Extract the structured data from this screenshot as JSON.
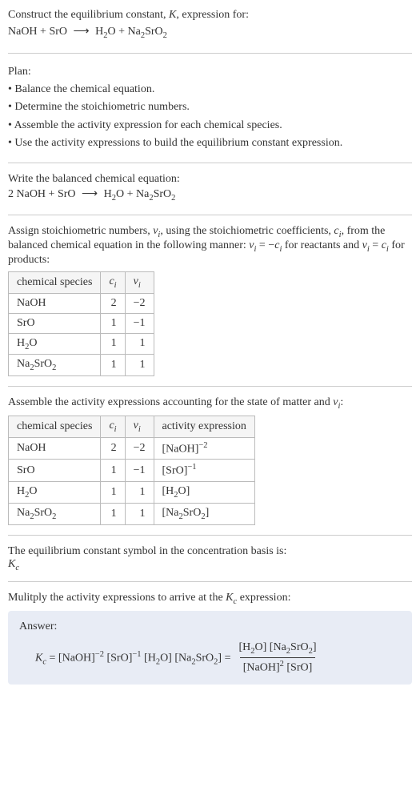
{
  "intro": {
    "line1_before": "Construct the equilibrium constant, ",
    "line1_K": "K",
    "line1_after": ", expression for:",
    "reaction_lhs1": "NaOH",
    "reaction_plus": " + ",
    "reaction_lhs2": "SrO",
    "reaction_arrow": "⟶",
    "reaction_rhs1": "H",
    "reaction_rhs1_sub": "2",
    "reaction_rhs1_end": "O",
    "reaction_rhs2": "Na",
    "reaction_rhs2_sub1": "2",
    "reaction_rhs2_mid": "SrO",
    "reaction_rhs2_sub2": "2"
  },
  "plan": {
    "header": "Plan:",
    "item1": "• Balance the chemical equation.",
    "item2": "• Determine the stoichiometric numbers.",
    "item3": "• Assemble the activity expression for each chemical species.",
    "item4": "• Use the activity expressions to build the equilibrium constant expression."
  },
  "balanced": {
    "header": "Write the balanced chemical equation:",
    "coef1": "2 ",
    "sp1": "NaOH",
    "plus": " + ",
    "sp2": "SrO",
    "arrow": "⟶",
    "sp3a": "H",
    "sp3sub": "2",
    "sp3b": "O",
    "sp4a": "Na",
    "sp4sub1": "2",
    "sp4b": "SrO",
    "sp4sub2": "2"
  },
  "stoich": {
    "text1": "Assign stoichiometric numbers, ",
    "nu": "ν",
    "nu_sub": "i",
    "text2": ", using the stoichiometric coefficients, ",
    "c": "c",
    "c_sub": "i",
    "text3": ", from the balanced chemical equation in the following manner: ",
    "eq1_lhs": "ν",
    "eq1_lhs_sub": "i",
    "eq1_eq": " = −",
    "eq1_rhs": "c",
    "eq1_rhs_sub": "i",
    "text4": " for reactants and ",
    "eq2_lhs": "ν",
    "eq2_lhs_sub": "i",
    "eq2_eq": " = ",
    "eq2_rhs": "c",
    "eq2_rhs_sub": "i",
    "text5": " for products:"
  },
  "table1": {
    "h1": "chemical species",
    "h2_sym": "c",
    "h2_sub": "i",
    "h3_sym": "ν",
    "h3_sub": "i",
    "rows": [
      {
        "sp": "NaOH",
        "sp_sub1": "",
        "sp_mid": "",
        "sp_sub2": "",
        "c": "2",
        "nu": "−2"
      },
      {
        "sp": "SrO",
        "sp_sub1": "",
        "sp_mid": "",
        "sp_sub2": "",
        "c": "1",
        "nu": "−1"
      },
      {
        "sp": "H",
        "sp_sub1": "2",
        "sp_mid": "O",
        "sp_sub2": "",
        "c": "1",
        "nu": "1"
      },
      {
        "sp": "Na",
        "sp_sub1": "2",
        "sp_mid": "SrO",
        "sp_sub2": "2",
        "c": "1",
        "nu": "1"
      }
    ]
  },
  "activity": {
    "text1": "Assemble the activity expressions accounting for the state of matter and ",
    "nu": "ν",
    "nu_sub": "i",
    "text2": ":"
  },
  "table2": {
    "h1": "chemical species",
    "h2_sym": "c",
    "h2_sub": "i",
    "h3_sym": "ν",
    "h3_sub": "i",
    "h4": "activity expression",
    "rows": [
      {
        "sp": "NaOH",
        "sp_sub1": "",
        "sp_mid": "",
        "sp_sub2": "",
        "c": "2",
        "nu": "−2",
        "act_open": "[NaOH]",
        "act_sup": "−2",
        "act_sub": ""
      },
      {
        "sp": "SrO",
        "sp_sub1": "",
        "sp_mid": "",
        "sp_sub2": "",
        "c": "1",
        "nu": "−1",
        "act_open": "[SrO]",
        "act_sup": "−1",
        "act_sub": ""
      },
      {
        "sp": "H",
        "sp_sub1": "2",
        "sp_mid": "O",
        "sp_sub2": "",
        "c": "1",
        "nu": "1",
        "act_open": "[H",
        "act_sup": "",
        "act_sub": "2",
        "act_close": "O]"
      },
      {
        "sp": "Na",
        "sp_sub1": "2",
        "sp_mid": "SrO",
        "sp_sub2": "2",
        "c": "1",
        "nu": "1",
        "act_open": "[Na",
        "act_sup": "",
        "act_sub": "2",
        "act_mid": "SrO",
        "act_sub2": "2",
        "act_close": "]"
      }
    ]
  },
  "symbol": {
    "text": "The equilibrium constant symbol in the concentration basis is:",
    "K": "K",
    "K_sub": "c"
  },
  "multiply": {
    "text1": "Mulitply the activity expressions to arrive at the ",
    "K": "K",
    "K_sub": "c",
    "text2": " expression:"
  },
  "answer": {
    "label": "Answer:",
    "Kc_sym": "K",
    "Kc_sub": "c",
    "eq": " = ",
    "term1": "[NaOH]",
    "term1_sup": "−2",
    "sp": " ",
    "term2": "[SrO]",
    "term2_sup": "−1",
    "term3_open": "[H",
    "term3_sub": "2",
    "term3_close": "O]",
    "term4_open": "[Na",
    "term4_sub1": "2",
    "term4_mid": "SrO",
    "term4_sub2": "2",
    "term4_close": "]",
    "eq2": " = ",
    "num1_open": "[H",
    "num1_sub": "2",
    "num1_close": "O]",
    "num2_open": "[Na",
    "num2_sub1": "2",
    "num2_mid": "SrO",
    "num2_sub2": "2",
    "num2_close": "]",
    "den1": "[NaOH]",
    "den1_sup": "2",
    "den2": "[SrO]"
  }
}
